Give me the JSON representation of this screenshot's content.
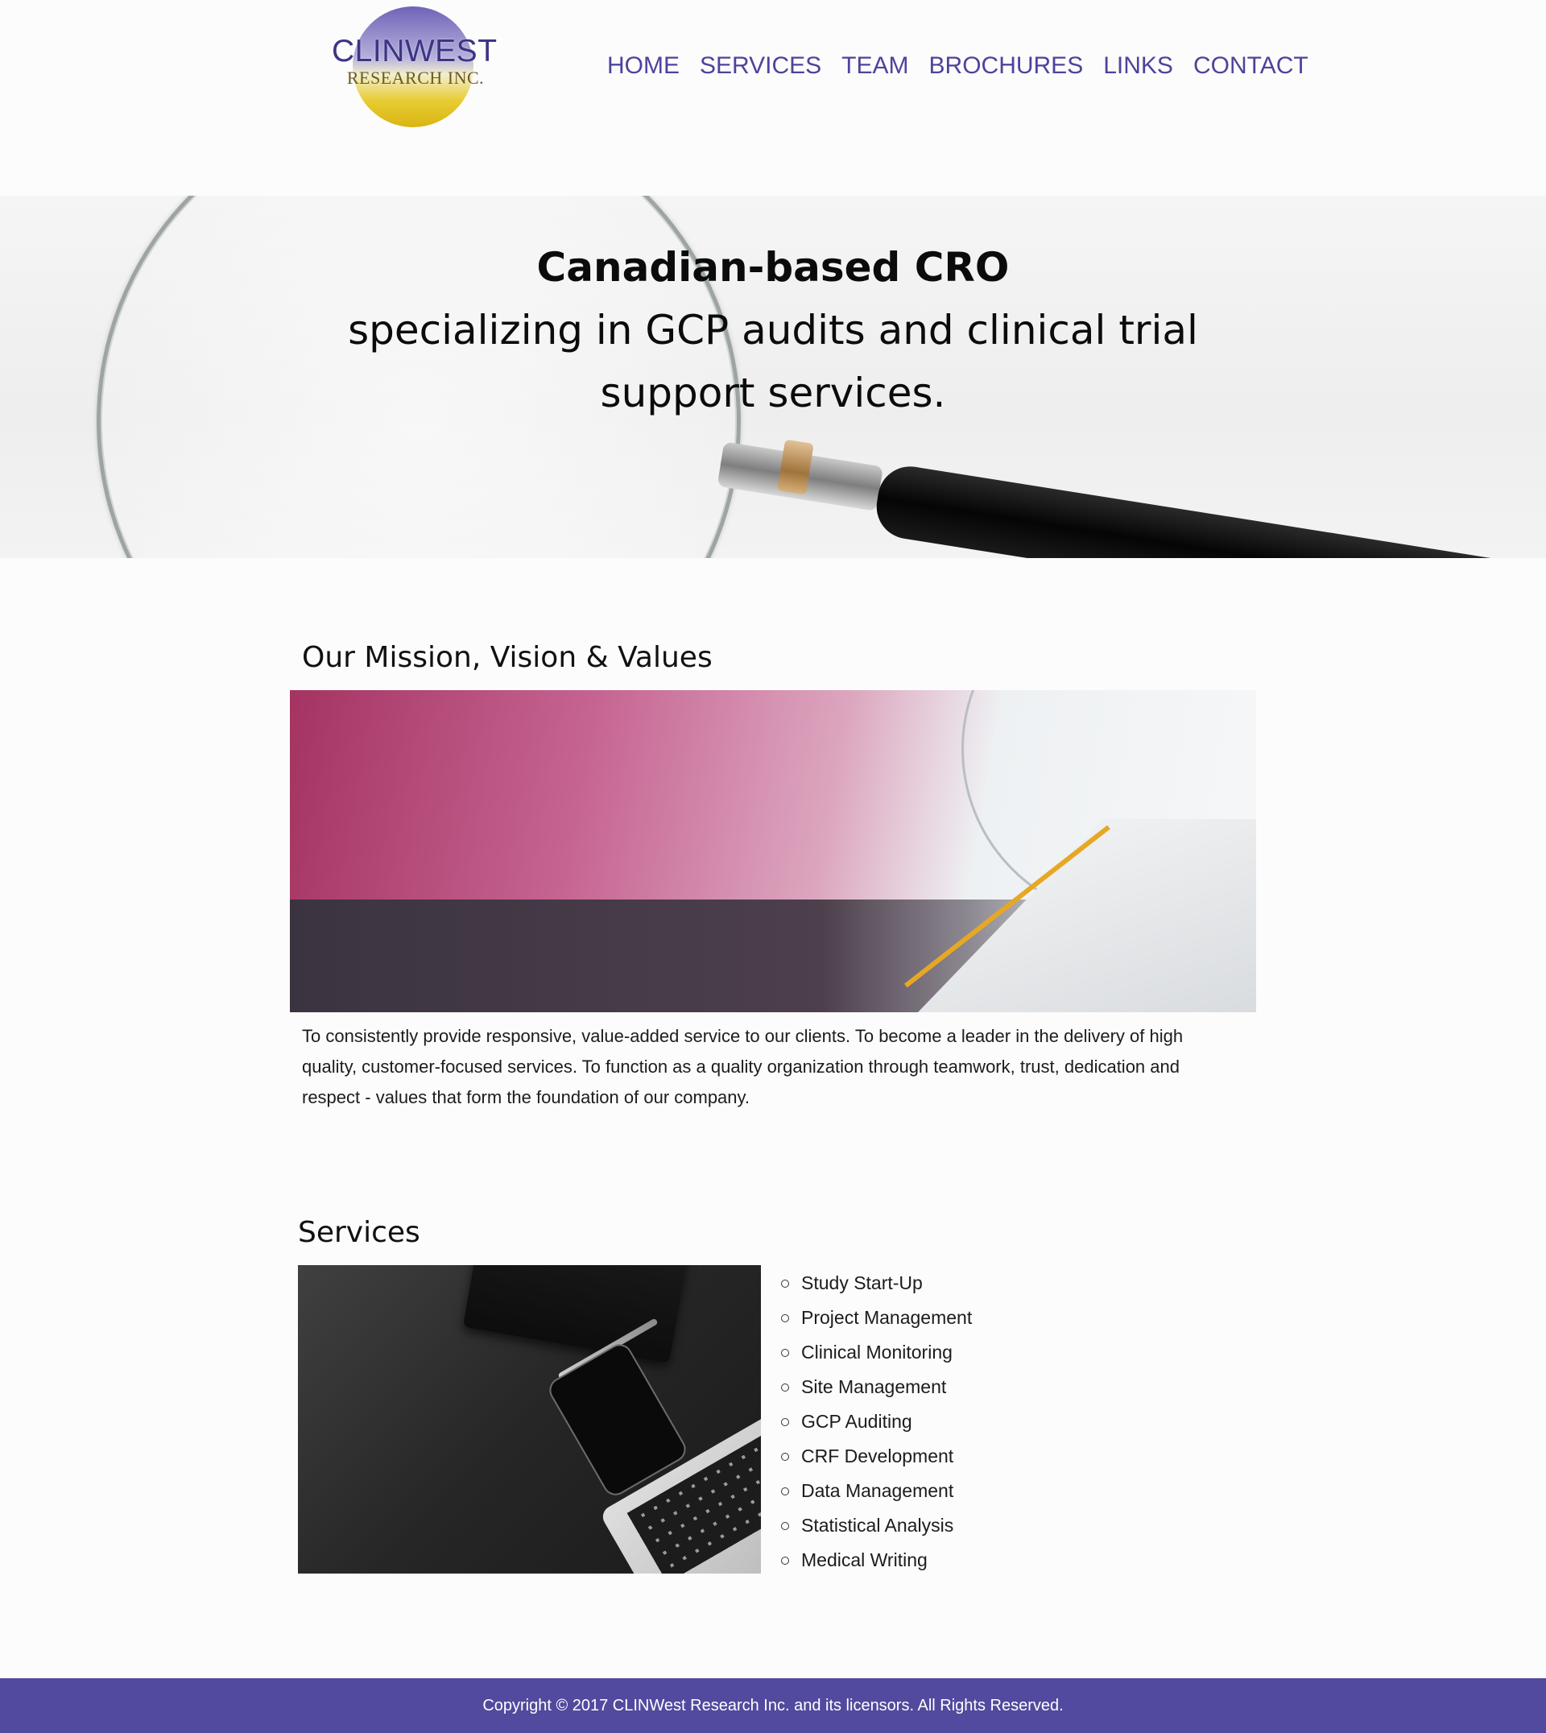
{
  "logo": {
    "line1": "CLINWEST",
    "line2": "RESEARCH INC."
  },
  "nav": {
    "items": [
      "HOME",
      "SERVICES",
      "TEAM",
      "BROCHURES",
      "LINKS",
      "CONTACT"
    ]
  },
  "hero": {
    "title": "Canadian-based CRO",
    "subtitle_line1": "specializing in GCP audits and clinical trial",
    "subtitle_line2": "support services."
  },
  "mission": {
    "heading": "Our Mission, Vision & Values",
    "text": "To consistently provide responsive, value-added service to our clients. To become a leader in the delivery of high quality, customer-focused services. To function as a quality organization through teamwork, trust, dedication and respect - values that form the foundation of our company."
  },
  "services": {
    "heading": "Services",
    "items": [
      "Study Start-Up",
      "Project Management",
      "Clinical Monitoring",
      "Site Management",
      "GCP Auditing",
      "CRF Development",
      "Data Management",
      "Statistical Analysis",
      "Medical Writing"
    ]
  },
  "footer": {
    "copyright": "Copyright © 2017 CLINWest Research Inc. and its licensors. All Rights Reserved."
  },
  "colors": {
    "brand_purple": "#514a9e",
    "nav_text": "#4c449c",
    "logo_gold": "#d9b512"
  }
}
